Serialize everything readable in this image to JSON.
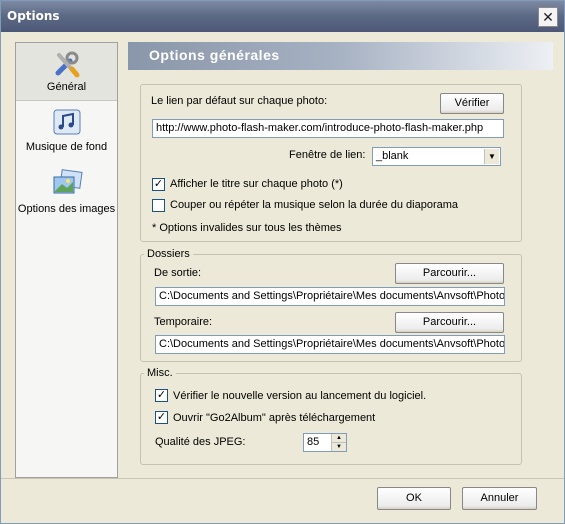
{
  "window": {
    "title": "Options",
    "close_glyph": "✕"
  },
  "sidebar": {
    "items": [
      {
        "label": "Général",
        "icon": "tools-icon"
      },
      {
        "label": "Musique de fond",
        "icon": "music-icon"
      },
      {
        "label": "Options des images",
        "icon": "images-icon"
      }
    ]
  },
  "main": {
    "header": "Options générales",
    "link_group": {
      "default_link_label": "Le lien par défaut sur chaque photo:",
      "verify_button": "Vérifier",
      "url_value": "http://www.photo-flash-maker.com/introduce-photo-flash-maker.php",
      "window_label": "Fenêtre de lien:",
      "window_value": "_blank",
      "show_title_label": "Afficher le titre sur chaque photo (*)",
      "show_title_checked": true,
      "cut_music_label": "Couper ou répéter la musique selon la durée du diaporama",
      "cut_music_checked": false,
      "note": "* Options invalides sur tous les thèmes"
    },
    "folders": {
      "legend": "Dossiers",
      "output_label": "De sortie:",
      "output_browse": "Parcourir...",
      "output_value": "C:\\Documents and Settings\\Propriétaire\\Mes documents\\Anvsoft\\Photo",
      "temp_label": "Temporaire:",
      "temp_browse": "Parcourir...",
      "temp_value": "C:\\Documents and Settings\\Propriétaire\\Mes documents\\Anvsoft\\Photo"
    },
    "misc": {
      "legend": "Misc.",
      "check_version_label": "Vérifier le nouvelle version au lancement du logiciel.",
      "check_version_checked": true,
      "open_album_label": "Ouvrir \"Go2Album\" après téléchargement",
      "open_album_checked": true,
      "jpeg_label": "Qualité des JPEG:",
      "jpeg_value": "85"
    }
  },
  "footer": {
    "ok": "OK",
    "cancel": "Annuler"
  },
  "check_glyph": "✓"
}
